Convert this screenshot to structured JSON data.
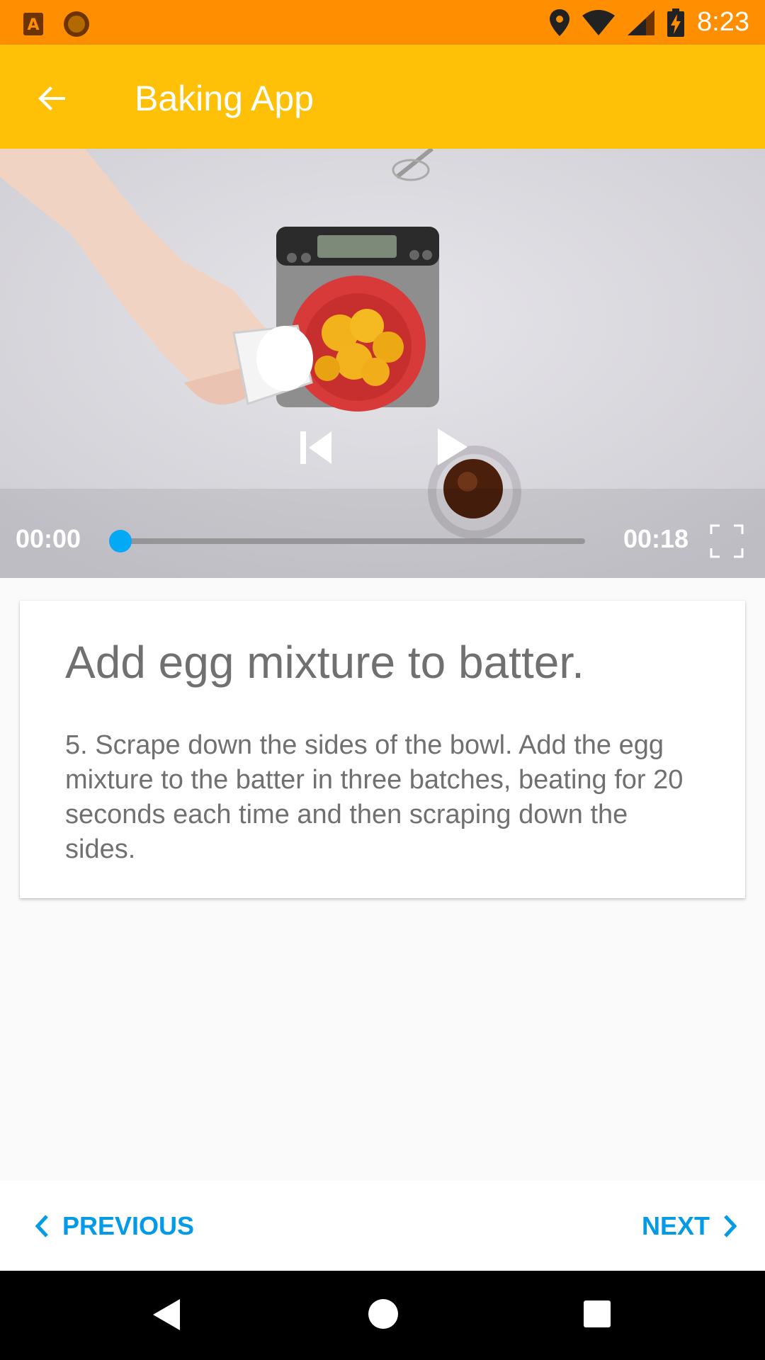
{
  "status_bar": {
    "time": "8:23",
    "icons": [
      "a-notification-icon",
      "circle-notification-icon",
      "location-icon",
      "wifi-icon",
      "signal-icon",
      "battery-charging-icon"
    ]
  },
  "app_bar": {
    "title": "Baking App",
    "back_icon": "arrow-back-icon",
    "color": "#ffc107"
  },
  "player": {
    "current_time": "00:00",
    "duration": "00:18",
    "progress": 0.0,
    "icons": [
      "previous-icon",
      "play-icon",
      "fullscreen-icon"
    ]
  },
  "step": {
    "title": "Add egg mixture to batter.",
    "description": "5. Scrape down the sides of the bowl. Add the egg mixture to the batter in three batches, beating for 20 seconds each time and then scraping down the sides."
  },
  "navigation": {
    "previous_label": "PREVIOUS",
    "next_label": "NEXT",
    "accent_color": "#039be5"
  }
}
